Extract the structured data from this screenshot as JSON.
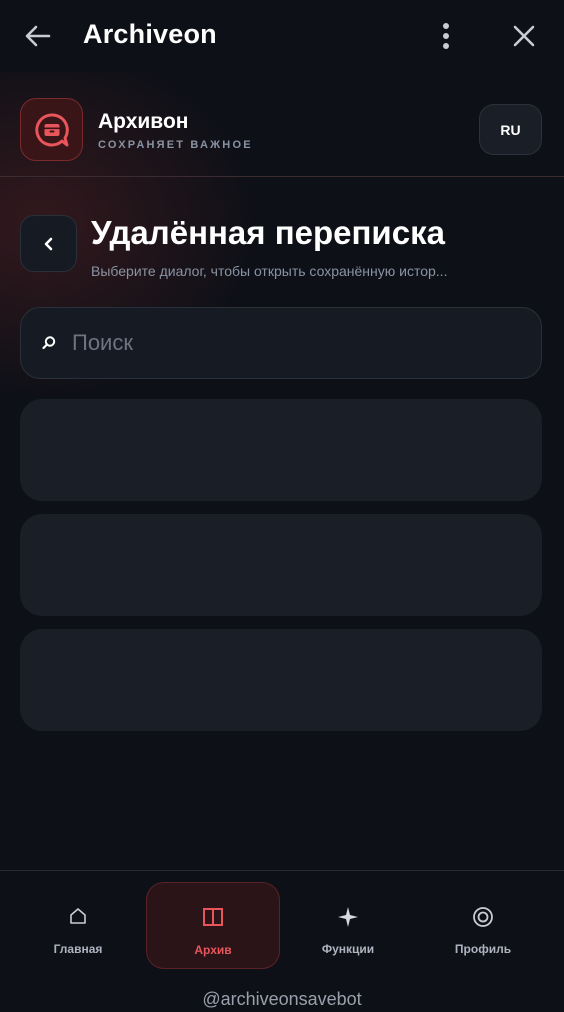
{
  "topbar": {
    "title": "Archiveon",
    "back_icon": "arrow-left-icon",
    "more_icon": "more-vertical-icon",
    "close_icon": "close-icon"
  },
  "brand": {
    "name": "Архивон",
    "tagline": "СОХРАНЯЕТ ВАЖНОЕ",
    "logo_icon": "archive-chat-icon"
  },
  "language": {
    "label": "RU"
  },
  "page": {
    "title": "Удалённая переписка",
    "subtitle": "Выберите диалог, чтобы открыть сохранённую истор..."
  },
  "search": {
    "placeholder": "Поиск",
    "value": ""
  },
  "dialogs": [
    {},
    {},
    {}
  ],
  "nav": {
    "items": [
      {
        "label": "Главная",
        "icon": "home-icon"
      },
      {
        "label": "Архив",
        "icon": "book-icon",
        "active": true
      },
      {
        "label": "Функции",
        "icon": "sparkle-icon"
      },
      {
        "label": "Профиль",
        "icon": "profile-ring-icon"
      }
    ]
  },
  "footer": {
    "handle": "@archiveonsavebot"
  },
  "colors": {
    "accent": "#e8555a",
    "background": "#0d1017",
    "card": "#1a1e26"
  }
}
